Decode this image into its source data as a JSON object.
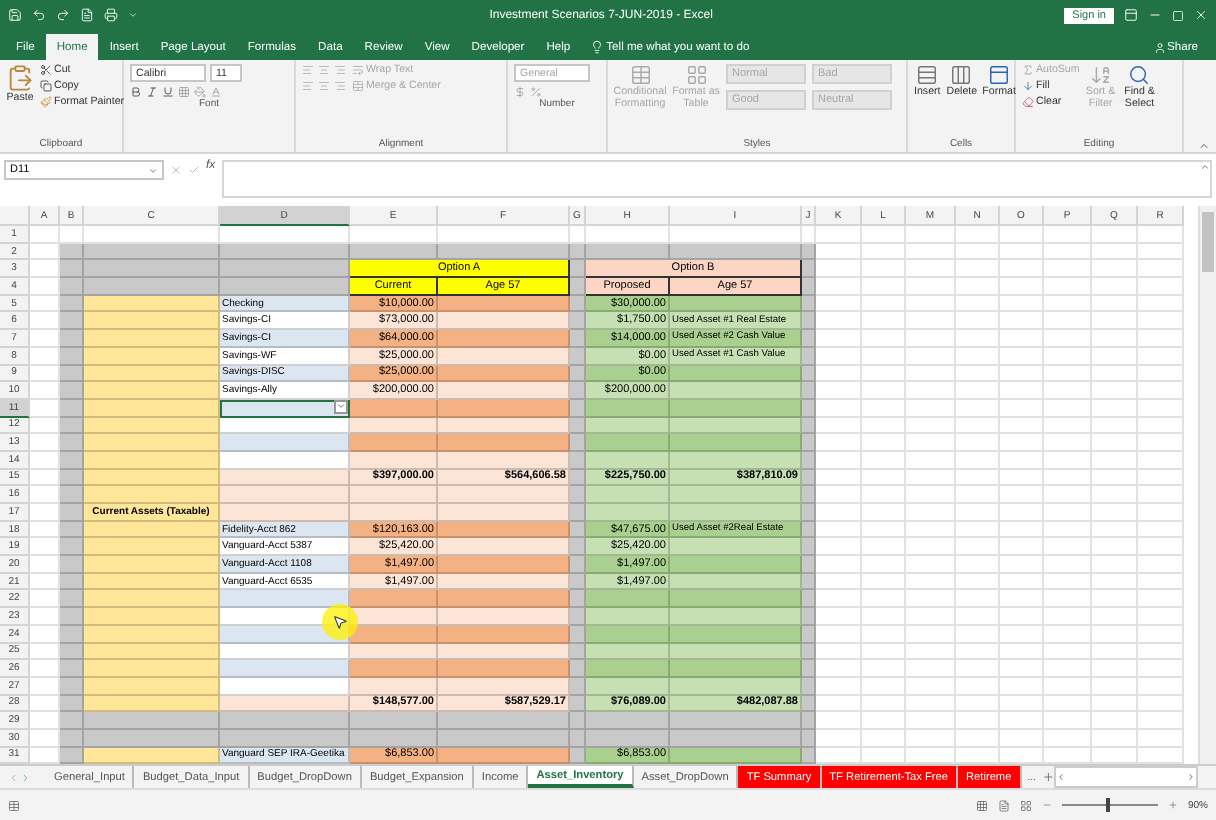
{
  "window": {
    "title": "Investment Scenarios 7-JUN-2019  -  Excel",
    "sign_in": "Sign in"
  },
  "ribbon_tabs": [
    {
      "label": "File",
      "selected": false
    },
    {
      "label": "Home",
      "selected": true
    },
    {
      "label": "Insert",
      "selected": false
    },
    {
      "label": "Page Layout",
      "selected": false
    },
    {
      "label": "Formulas",
      "selected": false
    },
    {
      "label": "Data",
      "selected": false
    },
    {
      "label": "Review",
      "selected": false
    },
    {
      "label": "View",
      "selected": false
    },
    {
      "label": "Developer",
      "selected": false
    },
    {
      "label": "Help",
      "selected": false
    }
  ],
  "tell_me": "Tell me what you want to do",
  "share": "Share",
  "ribbon_groups": [
    {
      "kind": "clipboard",
      "label": "Clipboard",
      "items": [
        {
          "label": "Paste",
          "disabled": false
        },
        {
          "label": "Cut",
          "disabled": false
        },
        {
          "label": "Copy",
          "disabled": false
        },
        {
          "label": "Format Painter",
          "disabled": false
        }
      ]
    },
    {
      "kind": "font",
      "label": "Font",
      "items": [
        {
          "label": "Calibri",
          "disabled": false
        },
        {
          "label": "11",
          "disabled": false
        }
      ]
    },
    {
      "kind": "alignment",
      "label": "Alignment",
      "items": [
        {
          "label": "Wrap Text",
          "disabled": true
        },
        {
          "label": "Merge & Center",
          "disabled": true
        }
      ]
    },
    {
      "kind": "number",
      "label": "Number",
      "items": [
        {
          "label": "General",
          "disabled": true
        }
      ]
    },
    {
      "kind": "styles",
      "label": "Styles",
      "items": [
        {
          "label": "Conditional Formatting",
          "disabled": true
        },
        {
          "label": "Format as Table",
          "disabled": true
        },
        {
          "label": "Normal",
          "disabled": true
        },
        {
          "label": "Bad",
          "disabled": true
        },
        {
          "label": "Good",
          "disabled": true
        },
        {
          "label": "Neutral",
          "disabled": true
        }
      ]
    },
    {
      "kind": "cells",
      "label": "Cells",
      "items": [
        {
          "label": "Insert",
          "disabled": false
        },
        {
          "label": "Delete",
          "disabled": false
        },
        {
          "label": "Format",
          "disabled": false
        }
      ]
    },
    {
      "kind": "editing",
      "label": "Editing",
      "items": [
        {
          "label": "AutoSum",
          "disabled": true
        },
        {
          "label": "Fill",
          "disabled": false
        },
        {
          "label": "Clear",
          "disabled": false
        },
        {
          "label": "Sort & Filter",
          "disabled": true
        },
        {
          "label": "Find & Select",
          "disabled": false
        }
      ]
    }
  ],
  "name_box": "D11",
  "fx": "fx",
  "columns": [
    {
      "label": "A",
      "selected": false
    },
    {
      "label": "B",
      "selected": false
    },
    {
      "label": "C",
      "selected": false
    },
    {
      "label": "D",
      "selected": true
    },
    {
      "label": "E",
      "selected": false
    },
    {
      "label": "F",
      "selected": false
    },
    {
      "label": "G",
      "selected": false
    },
    {
      "label": "H",
      "selected": false
    },
    {
      "label": "I",
      "selected": false
    },
    {
      "label": "J",
      "selected": false
    },
    {
      "label": "K",
      "selected": false
    },
    {
      "label": "L",
      "selected": false
    },
    {
      "label": "M",
      "selected": false
    },
    {
      "label": "N",
      "selected": false
    },
    {
      "label": "O",
      "selected": false
    },
    {
      "label": "P",
      "selected": false
    },
    {
      "label": "Q",
      "selected": false
    },
    {
      "label": "R",
      "selected": false
    }
  ],
  "options": [
    {
      "title": "Option A",
      "color": "#ffff00",
      "columns": [
        "Current",
        "Age 57"
      ]
    },
    {
      "title": "Option B",
      "color": "#fcd5c4",
      "columns": [
        "Proposed",
        "Age 57"
      ]
    }
  ],
  "rows": [
    {
      "number": "1",
      "kind": "blank"
    },
    {
      "number": "2",
      "kind": "gap"
    },
    {
      "number": "3",
      "kind": "option_titles"
    },
    {
      "number": "4",
      "kind": "option_columns"
    },
    {
      "number": "5",
      "kind": "item",
      "shaded": true,
      "selected": false,
      "account": "Checking",
      "current": "$10,000.00",
      "proposed": "$30,000.00"
    },
    {
      "number": "6",
      "kind": "item",
      "shaded": false,
      "selected": false,
      "account": "Savings-CI",
      "current": "$73,000.00",
      "proposed": "$1,750.00",
      "age_57_b": "Used Asset #1 Real Estate"
    },
    {
      "number": "7",
      "kind": "item",
      "shaded": true,
      "selected": false,
      "account": "Savings-CI",
      "current": "$64,000.00",
      "proposed": "$14,000.00",
      "age_57_b": "Used Asset #2 Cash Value"
    },
    {
      "number": "8",
      "kind": "item",
      "shaded": false,
      "selected": false,
      "account": "Savings-WF",
      "current": "$25,000.00",
      "proposed": "$0.00",
      "age_57_b": "Used Asset #1 Cash Value"
    },
    {
      "number": "9",
      "kind": "item",
      "shaded": true,
      "selected": false,
      "account": "Savings-DISC",
      "current": "$25,000.00",
      "proposed": "$0.00"
    },
    {
      "number": "10",
      "kind": "item",
      "shaded": false,
      "selected": false,
      "account": "Savings-Ally",
      "current": "$200,000.00",
      "proposed": "$200,000.00"
    },
    {
      "number": "11",
      "kind": "item",
      "shaded": true,
      "selected": true
    },
    {
      "number": "12",
      "kind": "item",
      "shaded": false,
      "selected": false
    },
    {
      "number": "13",
      "kind": "item",
      "shaded": true,
      "selected": false
    },
    {
      "number": "14",
      "kind": "item",
      "shaded": false,
      "selected": false
    },
    {
      "number": "15",
      "kind": "total",
      "current": "$397,000.00",
      "age_57_a": "$564,606.58",
      "proposed": "$225,750.00",
      "age_57_b": "$387,810.09"
    },
    {
      "number": "16",
      "kind": "spacer"
    },
    {
      "number": "17",
      "kind": "spacer",
      "group_label": "Current Assets (Taxable)"
    },
    {
      "number": "18",
      "kind": "item",
      "shaded": true,
      "selected": false,
      "account": "Fidelity-Acct 862",
      "current": "$120,163.00",
      "proposed": "$47,675.00",
      "age_57_b": "Used Asset #2Real Estate"
    },
    {
      "number": "19",
      "kind": "item",
      "shaded": false,
      "selected": false,
      "account": "Vanguard-Acct 5387",
      "current": "$25,420.00",
      "proposed": "$25,420.00"
    },
    {
      "number": "20",
      "kind": "item",
      "shaded": true,
      "selected": false,
      "account": "Vanguard-Acct 1108",
      "current": "$1,497.00",
      "proposed": "$1,497.00"
    },
    {
      "number": "21",
      "kind": "item",
      "shaded": false,
      "selected": false,
      "account": "Vanguard-Acct 6535",
      "current": "$1,497.00",
      "proposed": "$1,497.00"
    },
    {
      "number": "22",
      "kind": "item",
      "shaded": true,
      "selected": false
    },
    {
      "number": "23",
      "kind": "item",
      "shaded": false,
      "selected": false
    },
    {
      "number": "24",
      "kind": "item",
      "shaded": true,
      "selected": false
    },
    {
      "number": "25",
      "kind": "item",
      "shaded": false,
      "selected": false
    },
    {
      "number": "26",
      "kind": "item",
      "shaded": true,
      "selected": false
    },
    {
      "number": "27",
      "kind": "item",
      "shaded": false,
      "selected": false
    },
    {
      "number": "28",
      "kind": "total",
      "current": "$148,577.00",
      "age_57_a": "$587,529.17",
      "proposed": "$76,089.00",
      "age_57_b": "$482,087.88"
    },
    {
      "number": "29",
      "kind": "gap"
    },
    {
      "number": "30",
      "kind": "gap"
    },
    {
      "number": "31",
      "kind": "item",
      "shaded": true,
      "selected": false,
      "account": "Vanguard SEP IRA-Geetika",
      "current": "$6,853.00",
      "proposed": "$6,853.00"
    }
  ],
  "sheet_tabs": [
    {
      "label": "General_Input",
      "selected": false
    },
    {
      "label": "Budget_Data_Input",
      "selected": false
    },
    {
      "label": "Budget_DropDown",
      "selected": false
    },
    {
      "label": "Budget_Expansion",
      "selected": false
    },
    {
      "label": "Income",
      "selected": false
    },
    {
      "label": "Asset_Inventory",
      "selected": true
    },
    {
      "label": "Asset_DropDown",
      "selected": false
    },
    {
      "label": "TF Summary",
      "selected": false,
      "color": "#ff0000"
    },
    {
      "label": "TF Retirement-Tax Free",
      "selected": false,
      "color": "#ff0000"
    },
    {
      "label": "Retireme",
      "selected": false,
      "color": "#ff0000"
    }
  ],
  "more_tabs": "...",
  "zoom": {
    "level": 0.45,
    "reading": "90%"
  }
}
